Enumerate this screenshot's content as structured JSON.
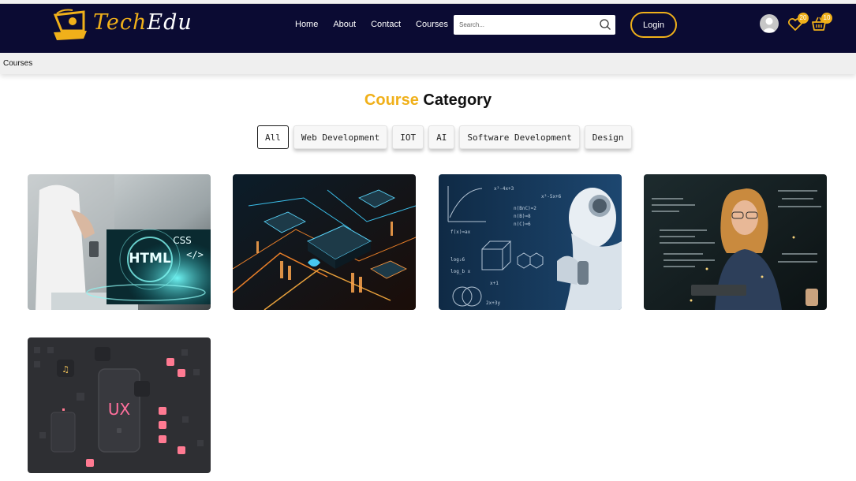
{
  "brand": {
    "name_first": "Tech",
    "name_second": "Edu"
  },
  "nav": {
    "home": "Home",
    "about": "About",
    "contact": "Contact",
    "courses": "Courses"
  },
  "search": {
    "placeholder": "Search..."
  },
  "login_label": "Login",
  "badges": {
    "wishlist_count": "20",
    "cart_count": "10"
  },
  "breadcrumb": {
    "current": "Courses"
  },
  "section": {
    "title_accent": "Course",
    "title_rest": "Category"
  },
  "filters": [
    "All",
    "Web Development",
    "IOT",
    "AI",
    "Software Development",
    "Design"
  ],
  "active_filter": "All",
  "cards": {
    "html": {
      "badge_main": "HTML",
      "badge_css": "CSS",
      "badge_tag": "</>"
    },
    "design": {
      "label": "UX"
    }
  },
  "colors": {
    "navbar": "#0b0b33",
    "accent": "#f0b01a"
  }
}
